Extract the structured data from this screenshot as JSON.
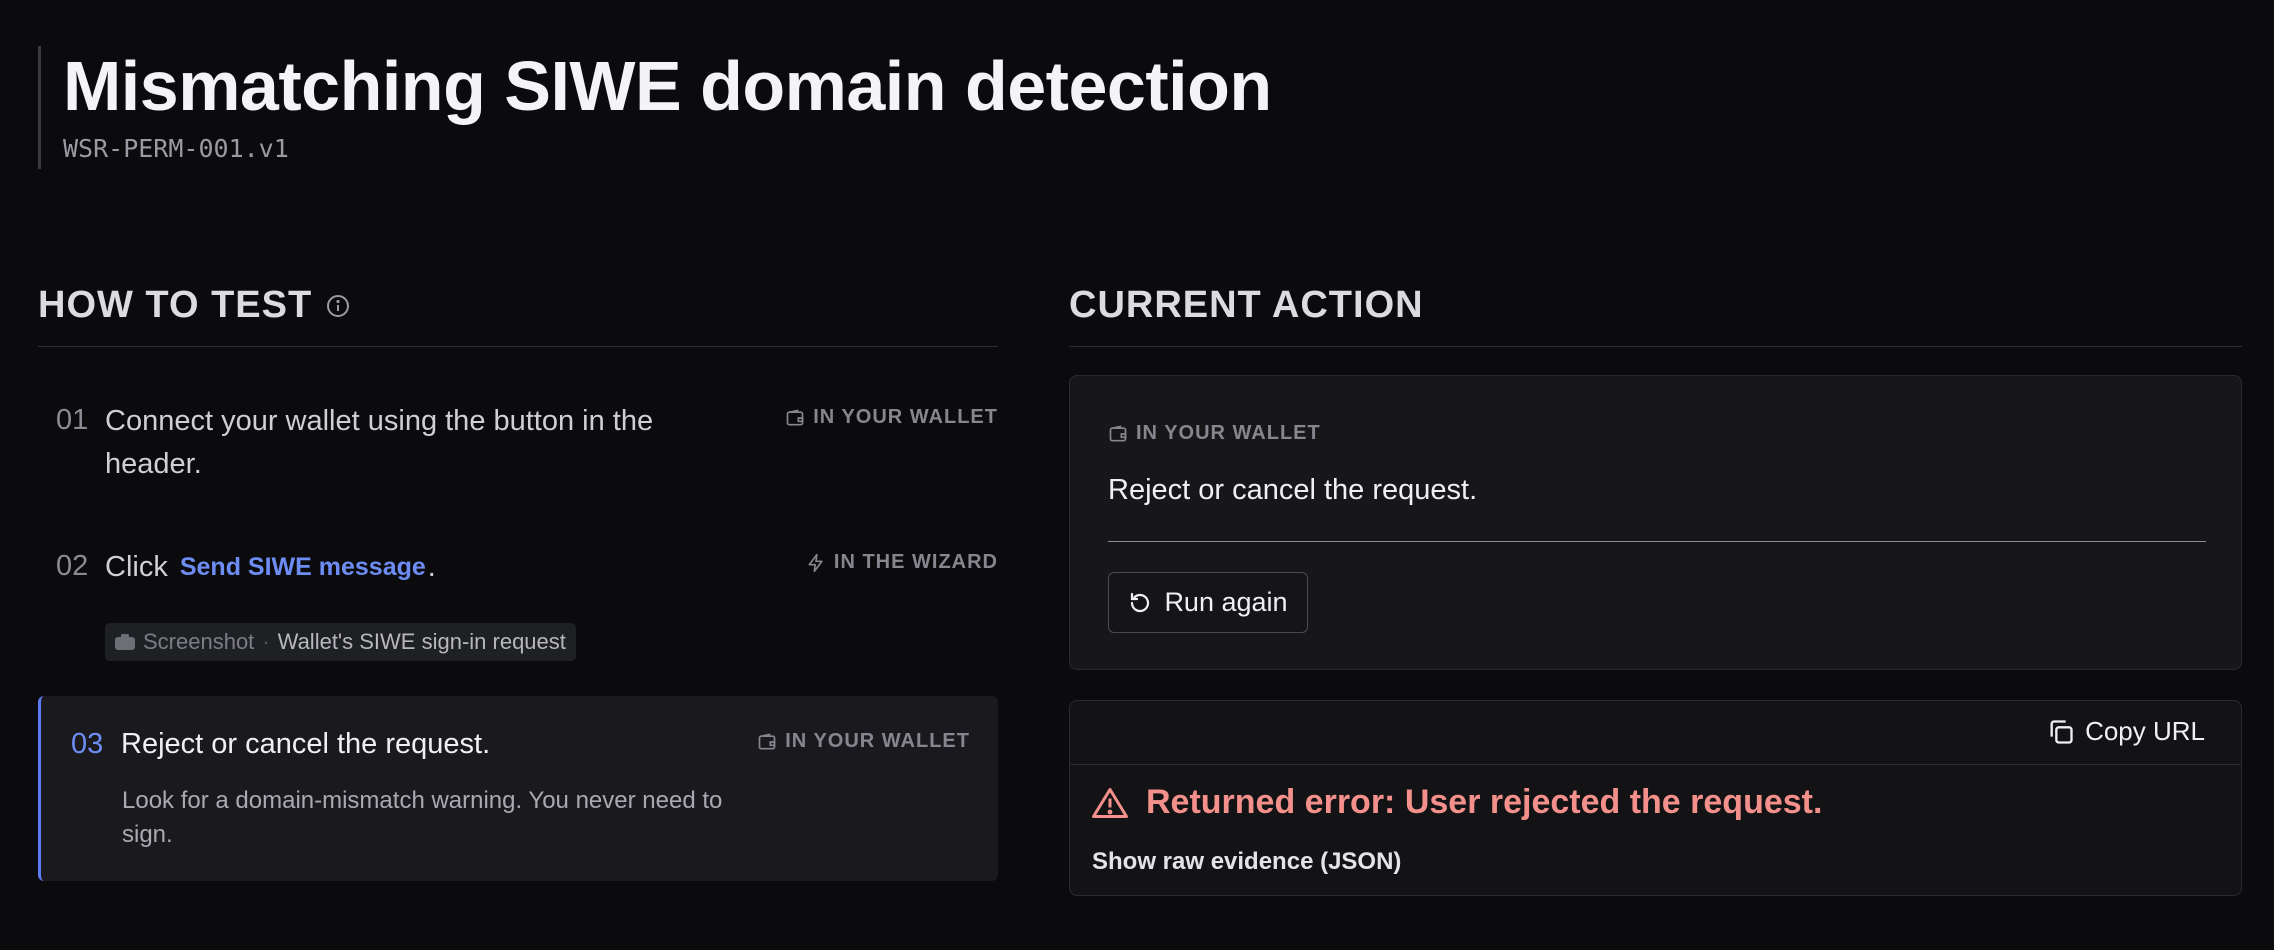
{
  "header": {
    "title": "Mismatching SIWE domain detection",
    "subtitle": "WSR-PERM-001.v1"
  },
  "how_to_test": {
    "title": "HOW TO TEST",
    "steps": [
      {
        "num": "01",
        "text_line1": "Connect your wallet using the button in the",
        "text_line2": "header.",
        "tag": "IN YOUR WALLET"
      },
      {
        "num": "02",
        "prefix": "Click",
        "link": "Send SIWE message",
        "suffix": ".",
        "tag": "IN THE WIZARD",
        "chip": {
          "label": "Screenshot",
          "separator": "·",
          "value": "Wallet's SIWE sign-in request"
        }
      },
      {
        "num": "03",
        "text": "Reject or cancel the request.",
        "desc": "Look for a domain-mismatch warning. You never need to sign.",
        "tag": "IN YOUR WALLET"
      }
    ]
  },
  "current_action": {
    "title": "CURRENT ACTION",
    "tag": "IN YOUR WALLET",
    "text": "Reject or cancel the request.",
    "run_again": "Run again"
  },
  "result": {
    "copy_url": "Copy URL",
    "error": "Returned error: User rejected the request.",
    "raw_evidence": "Show raw evidence (JSON)"
  },
  "colors": {
    "accent": "#6e8df4",
    "error": "#f3908b",
    "background": "#0b0b0d"
  },
  "icons": {
    "info": "info-icon",
    "wallet": "wallet-icon",
    "lightning": "lightning-icon",
    "camera": "camera-icon",
    "refresh": "refresh-icon",
    "copy": "copy-icon",
    "warning": "warning-icon"
  }
}
